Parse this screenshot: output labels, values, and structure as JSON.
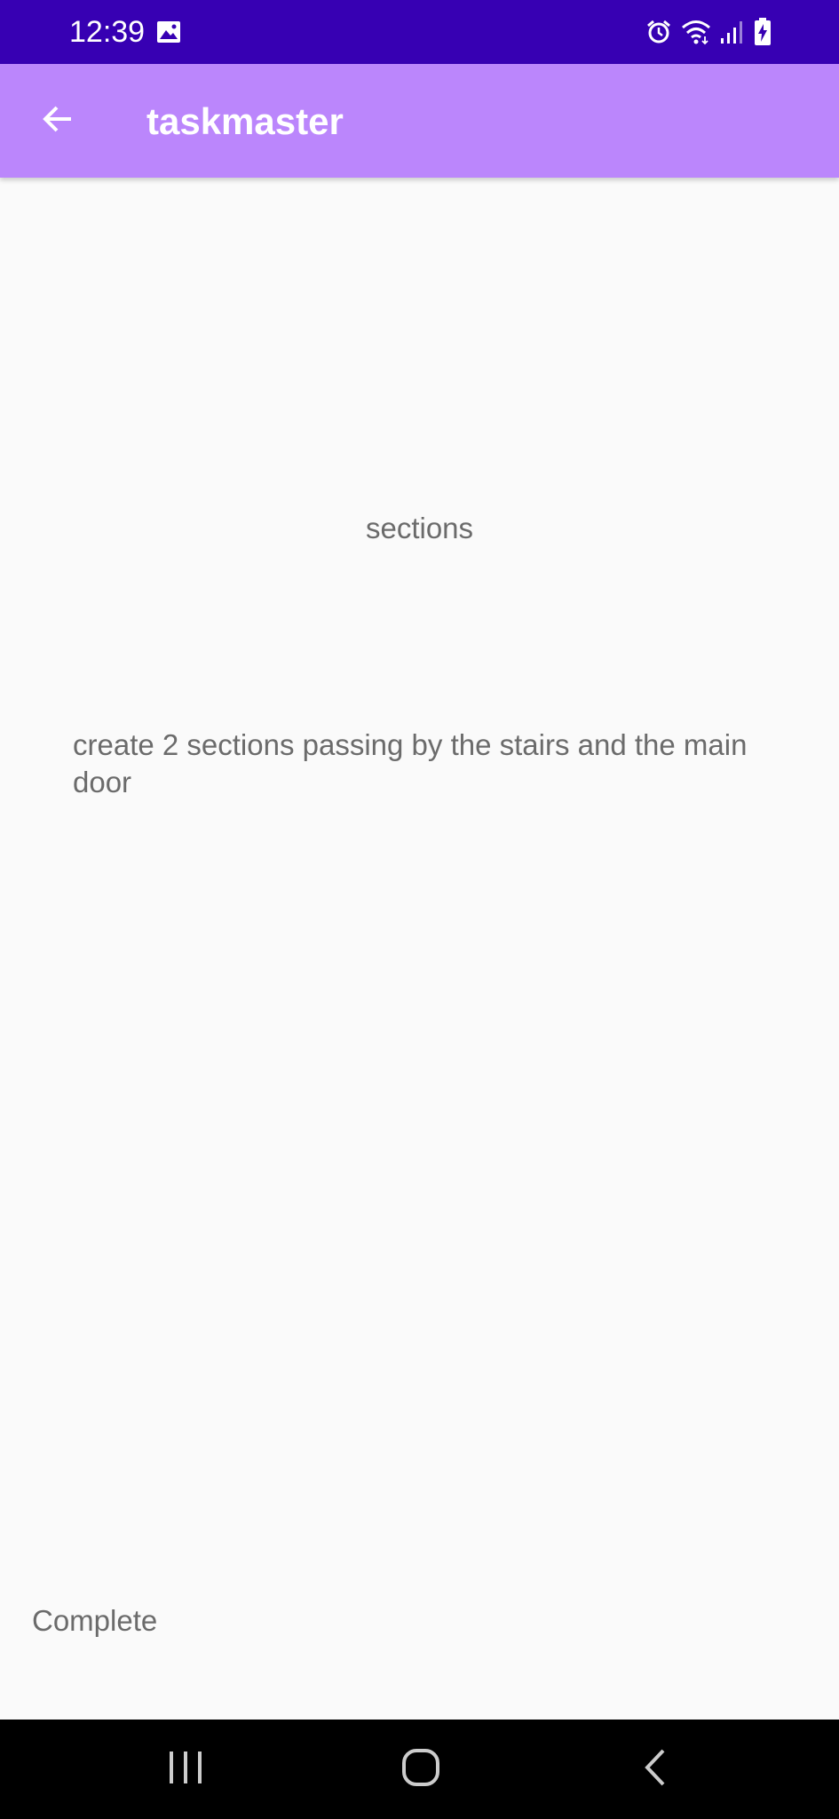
{
  "status_bar": {
    "time": "12:39",
    "icons": [
      "gallery-icon",
      "alarm-icon",
      "wifi-icon",
      "signal-icon",
      "battery-charging-icon"
    ]
  },
  "app_bar": {
    "title": "taskmaster",
    "back_icon": "arrow-back-icon",
    "background": "#bb86fc"
  },
  "task": {
    "title": "sections",
    "description": "create 2 sections passing by the stairs and the main door",
    "status": "Complete"
  },
  "nav_bar": {
    "icons": [
      "recents-icon",
      "home-icon",
      "back-icon"
    ]
  },
  "colors": {
    "status_bar": "#3700b3",
    "app_bar": "#bb86fc",
    "text": "#6b6b6b",
    "background": "#fafafa"
  }
}
